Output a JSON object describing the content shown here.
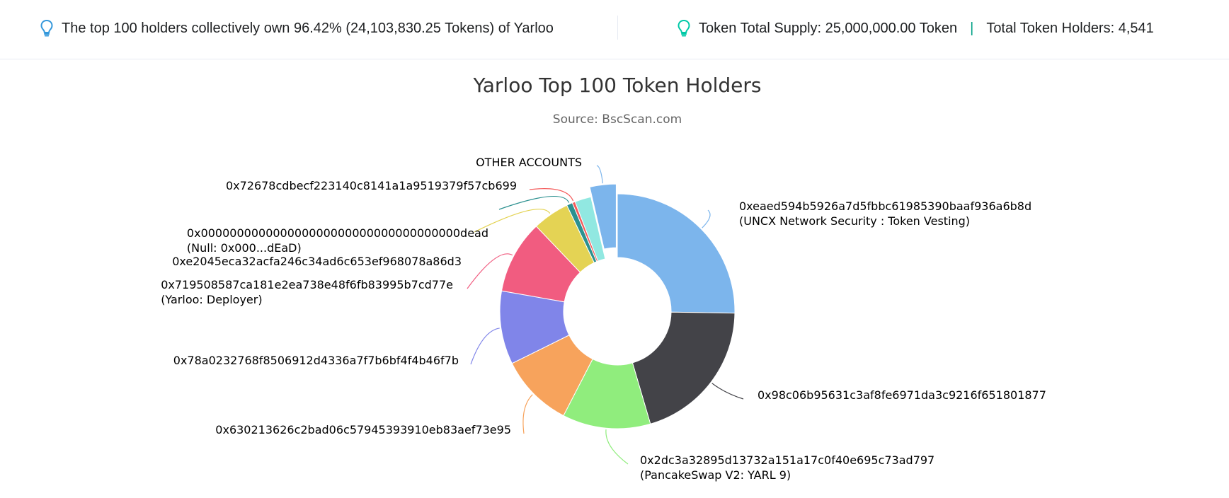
{
  "summary": {
    "top_holders_text": "The top 100 holders collectively own 96.42% (24,103,830.25 Tokens) of Yarloo",
    "total_supply_text": "Token Total Supply: 25,000,000.00 Token",
    "separator": "|",
    "total_holders_text": "Total Token Holders: 4,541"
  },
  "colors": {
    "bulb_left": "#3498db",
    "bulb_right": "#00c9a7",
    "separator": "#00a186"
  },
  "icons": {
    "info_bulb": "lightbulb-icon"
  },
  "chart_data": {
    "type": "pie",
    "style": "donut",
    "title": "Yarloo Top 100 Token Holders",
    "subtitle": "Source: BscScan.com",
    "unit": "percent of total supply (approx.)",
    "slices": [
      {
        "label": "0xeaed594b5926a7d5fbbc61985390baaf936a6b8d",
        "sublabel": "(UNCX Network Security : Token Vesting)",
        "value": 25.0,
        "color": "#7cb5ec",
        "side": "right",
        "label_pos": "upper"
      },
      {
        "label": "0x98c06b95631c3af8fe6971da3c9216f651801877",
        "sublabel": "",
        "value": 20.0,
        "color": "#434348",
        "side": "right",
        "label_pos": "lower"
      },
      {
        "label": "0x2dc3a32895d13732a151a17c0f40e695c73ad797",
        "sublabel": "(PancakeSwap V2: YARL 9)",
        "value": 12.0,
        "color": "#90ed7d",
        "side": "right",
        "label_pos": "bottom"
      },
      {
        "label": "0x630213626c2bad06c57945393910eb83aef73e95",
        "sublabel": "",
        "value": 10.0,
        "color": "#f7a35c",
        "side": "left",
        "label_pos": "bottom"
      },
      {
        "label": "0x78a0232768f8506912d4336a7f7b6bf4f4b46f7b",
        "sublabel": "",
        "value": 10.0,
        "color": "#8085e9",
        "side": "left",
        "label_pos": "middle"
      },
      {
        "label": "0x719508587ca181e2ea738e48f6fb83995b7cd77e",
        "sublabel": "(Yarloo: Deployer)",
        "value": 10.0,
        "color": "#f15c80",
        "side": "left",
        "label_pos": "upper-middle"
      },
      {
        "label": "0xe2045eca32acfa246c34ad6c653ef968078a86d3",
        "sublabel": "",
        "value": 5.0,
        "color": "#e4d354",
        "side": "left",
        "label_pos": "upper"
      },
      {
        "label": "0x000000000000000000000000000000000000dead",
        "sublabel": "(Null: 0x000...dEaD)",
        "value": 0.8,
        "color": "#2b908f",
        "side": "left",
        "label_pos": "upper"
      },
      {
        "label": "0x72678cdbecf223140c8141a1a9519379f57cb699",
        "sublabel": "",
        "value": 0.4,
        "color": "#f45b5b",
        "side": "left",
        "label_pos": "top"
      },
      {
        "label": "",
        "sublabel": "",
        "value": 2.22,
        "color": "#91e8e1",
        "side": "left",
        "label_pos": "unlabeled"
      },
      {
        "label": "OTHER ACCOUNTS",
        "sublabel": "",
        "value": 3.58,
        "color": "#7cb5ec",
        "side": "left",
        "label_pos": "top",
        "sliced": true
      }
    ]
  }
}
